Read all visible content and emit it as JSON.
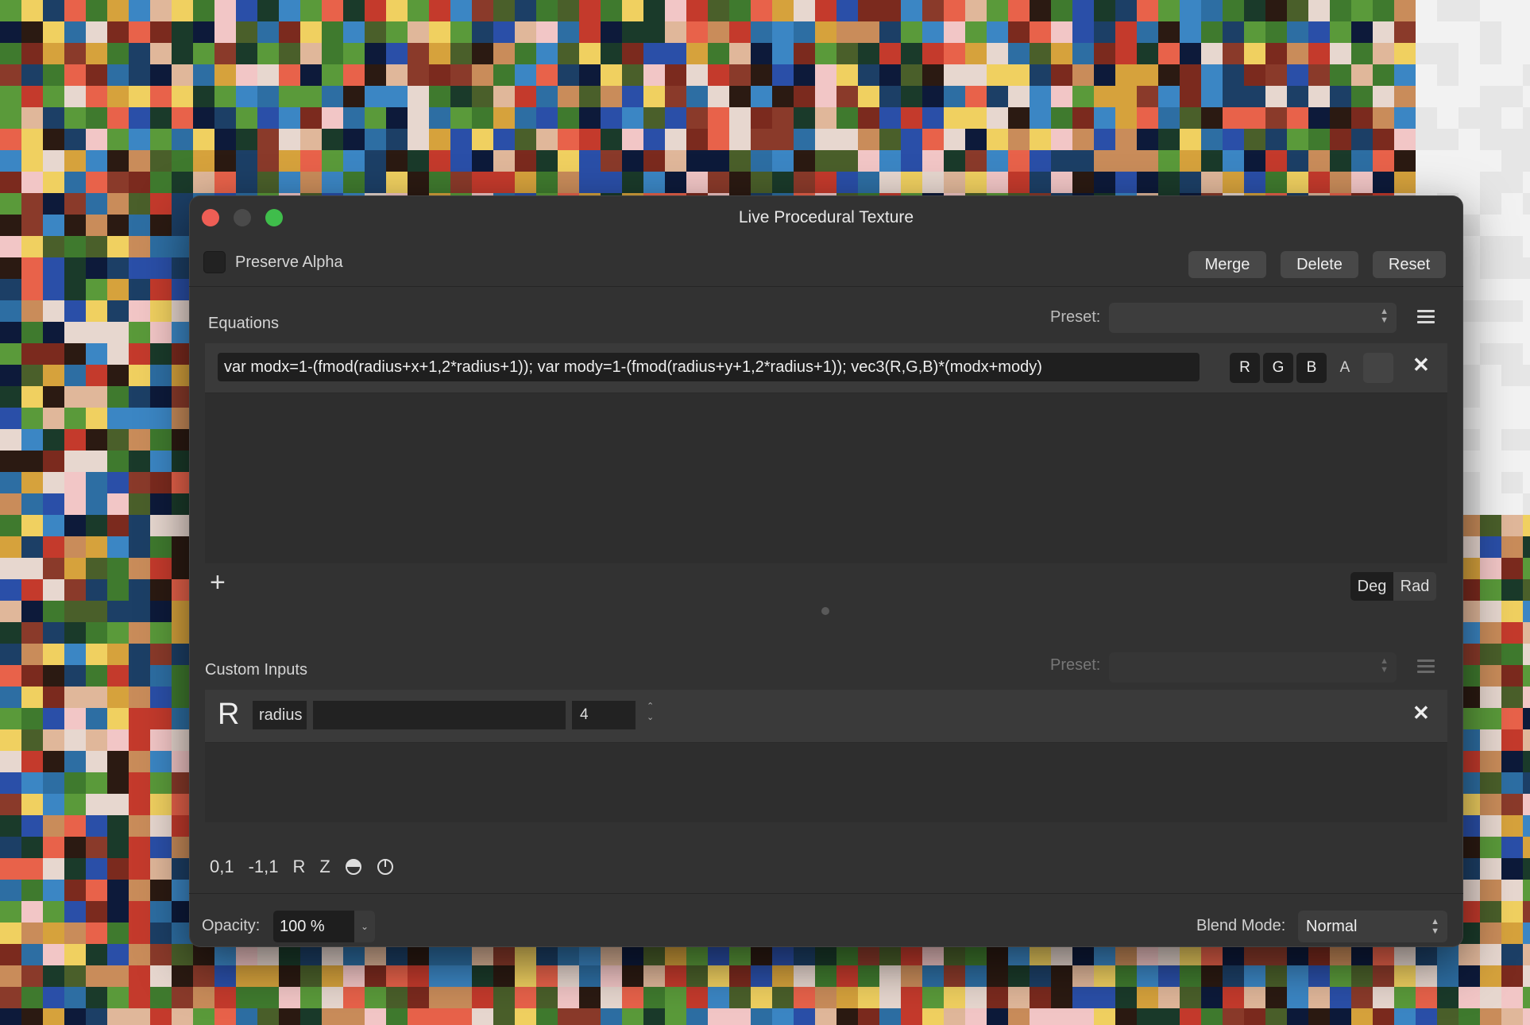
{
  "window": {
    "title": "Live Procedural Texture"
  },
  "top": {
    "preserve_alpha_label": "Preserve Alpha",
    "merge_label": "Merge",
    "delete_label": "Delete",
    "reset_label": "Reset"
  },
  "equations": {
    "section_label": "Equations",
    "preset_label": "Preset:",
    "preset_value": "",
    "rows": [
      {
        "expression": "var modx=1-(fmod(radius+x+1,2*radius+1)); var mody=1-(fmod(radius+y+1,2*radius+1)); vec3(R,G,B)*(modx+mody)"
      }
    ],
    "channels": [
      "R",
      "G",
      "B",
      "A"
    ],
    "deg_label": "Deg",
    "rad_label": "Rad",
    "angle_mode": "Deg"
  },
  "custom_inputs": {
    "section_label": "Custom Inputs",
    "preset_label": "Preset:",
    "rows": [
      {
        "type_letter": "R",
        "name": "radius",
        "description": "",
        "value": "4"
      }
    ]
  },
  "tools": {
    "items": [
      "0,1",
      "-1,1",
      "R",
      "Z"
    ]
  },
  "bottom": {
    "opacity_label": "Opacity:",
    "opacity_value": "100 %",
    "blend_label": "Blend Mode:",
    "blend_value": "Normal"
  },
  "colors": {
    "window_bg": "#323232",
    "close": "#ee5e55",
    "maximize": "#3fbd4b"
  }
}
